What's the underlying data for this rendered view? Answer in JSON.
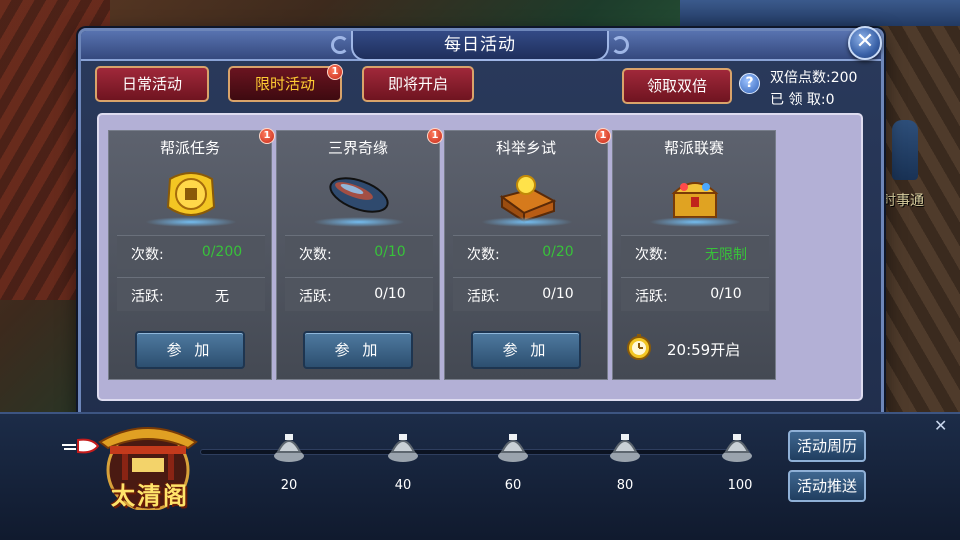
{
  "title": "每日活动",
  "tabs": [
    {
      "label": "日常活动",
      "active": false,
      "badge": ""
    },
    {
      "label": "限时活动",
      "active": true,
      "badge": "1"
    },
    {
      "label": "即将开启",
      "active": false,
      "badge": ""
    }
  ],
  "claim_double_label": "领取双倍",
  "help_label": "?",
  "double_points": "双倍点数:200",
  "claimed": "已 领 取:0",
  "close_label": "✕",
  "cards": [
    {
      "title": "帮派任务",
      "badge": "1",
      "icon": "gold-coin-icon",
      "count_key": "次数:",
      "count_value": "0/200",
      "activity_key": "活跃:",
      "activity_value": "无",
      "action_label": "参 加"
    },
    {
      "title": "三界奇缘",
      "badge": "1",
      "icon": "jade-stone-icon",
      "count_key": "次数:",
      "count_value": "0/10",
      "activity_key": "活跃:",
      "activity_value": "0/10",
      "action_label": "参 加"
    },
    {
      "title": "科举乡试",
      "badge": "1",
      "icon": "treasure-box-icon",
      "count_key": "次数:",
      "count_value": "0/20",
      "activity_key": "活跃:",
      "activity_value": "0/10",
      "action_label": "参 加"
    },
    {
      "title": "帮派联赛",
      "badge": "",
      "icon": "treasure-chest-icon",
      "count_key": "次数:",
      "count_value": "无限制",
      "activity_key": "活跃:",
      "activity_value": "0/10",
      "open_time": "20:59开启"
    }
  ],
  "progress": {
    "pavilion_name": "太清阁",
    "milestones": [
      "20",
      "40",
      "60",
      "80",
      "100"
    ],
    "value": 0
  },
  "side_buttons": [
    "活动周历",
    "活动推送"
  ],
  "npc_label": "时事通",
  "colors": {
    "tab_red": "#8c1c2b",
    "active_tab_text": "#ffcc33",
    "green_value": "#38c23a",
    "content_bg": "#b3b0d6",
    "card_bg": "#505560"
  }
}
